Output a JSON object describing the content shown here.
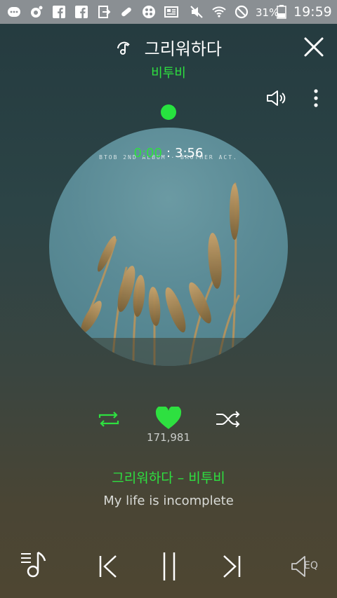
{
  "status_bar": {
    "battery": "31%",
    "clock": "19:59"
  },
  "player": {
    "title": "그리워하다",
    "artist": "비투비",
    "album_text": "BTOB 2ND ALBUM · BROTHER ACT.",
    "time_current": "0:00",
    "time_separator": ":",
    "time_total": "3:56",
    "likes": "171,981",
    "song_line": "그리워하다 – 비투비",
    "lyric": "My life is incomplete",
    "eq_label": "EQ"
  },
  "colors": {
    "accent": "#2ee040",
    "status_bar": "#8a8f93"
  },
  "icons": {
    "repeat": "repeat-icon",
    "heart": "heart-icon",
    "shuffle": "shuffle-icon",
    "playlist": "playlist-icon",
    "prev": "previous-icon",
    "pause": "pause-icon",
    "next": "next-icon",
    "eq": "equalizer-icon"
  }
}
